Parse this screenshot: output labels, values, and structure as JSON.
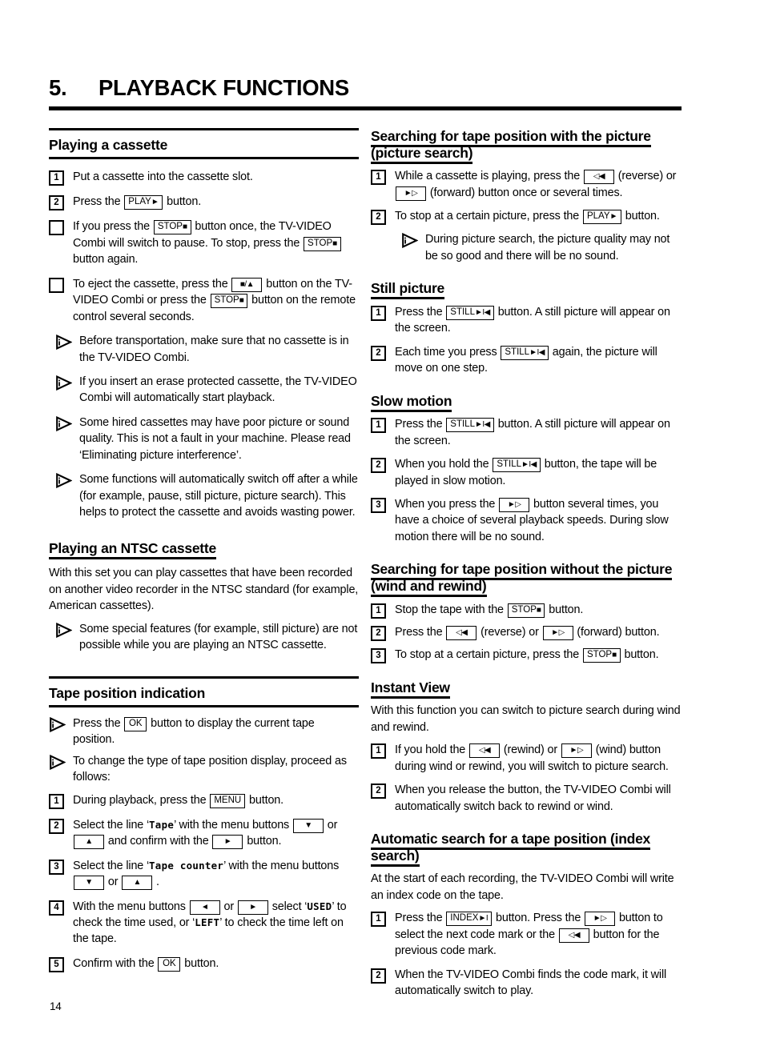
{
  "chapter": {
    "number": "5.",
    "title": "PLAYBACK FUNCTIONS"
  },
  "page_number": "14",
  "keys": {
    "play": "PLAY",
    "play_glyph": "►",
    "stop": "STOP",
    "stop_glyph": "■",
    "eject": "■/▲",
    "rewind": "◁◀",
    "forward": "►▷",
    "still": "STILL",
    "still_glyph": "►I◀",
    "index": "INDEX",
    "index_glyph": "►I",
    "ok": "OK",
    "menu": "MENU",
    "down": "▼",
    "up": "▲",
    "left": "◄",
    "right": "►"
  },
  "left_column": {
    "section_playing": {
      "heading": "Playing a cassette",
      "steps": [
        {
          "marker": "1",
          "parts": [
            {
              "t": "text",
              "v": "Put a cassette into the cassette slot."
            }
          ]
        },
        {
          "marker": "2",
          "parts": [
            {
              "t": "text",
              "v": "Press the "
            },
            {
              "t": "key",
              "v": "play"
            },
            {
              "t": "text",
              "v": " button."
            }
          ]
        },
        {
          "marker": "box",
          "parts": [
            {
              "t": "text",
              "v": "If you press the "
            },
            {
              "t": "key",
              "v": "stop"
            },
            {
              "t": "text",
              "v": " button once, the TV-VIDEO Combi will switch to pause. To stop, press the "
            },
            {
              "t": "key",
              "v": "stop"
            },
            {
              "t": "text",
              "v": " button again."
            }
          ]
        },
        {
          "marker": "box",
          "parts": [
            {
              "t": "text",
              "v": "To eject the cassette, press the "
            },
            {
              "t": "key",
              "v": "eject"
            },
            {
              "t": "text",
              "v": " button on the TV-VIDEO Combi or press the "
            },
            {
              "t": "key",
              "v": "stop"
            },
            {
              "t": "text",
              "v": " button on the remote control several seconds."
            }
          ]
        }
      ],
      "tips": [
        "Before transportation, make sure that no cassette is in the TV-VIDEO Combi.",
        "If you insert an erase protected cassette, the TV-VIDEO Combi will automatically start playback.",
        "Some hired cassettes may have poor picture or sound quality. This is not a fault in your machine. Please read ‘Eliminating picture interference’.",
        "Some functions will automatically switch off after a while (for example, pause, still picture, picture search). This helps to protect the cassette and avoids wasting power."
      ]
    },
    "section_ntsc": {
      "heading": "Playing an NTSC cassette",
      "body": "With this set you can play cassettes that have been recorded on another video recorder in the NTSC standard (for example, American cassettes).",
      "tip": "Some special features (for example, still picture) are not possible while you are playing an NTSC cassette."
    },
    "section_tape_position": {
      "heading": "Tape position indication",
      "tip1_parts": [
        {
          "t": "text",
          "v": "Press the "
        },
        {
          "t": "key",
          "v": "ok"
        },
        {
          "t": "text",
          "v": " button to display the current tape position."
        }
      ],
      "tip2": "To change the type of tape position display, proceed as follows:",
      "steps": [
        {
          "marker": "1",
          "parts": [
            {
              "t": "text",
              "v": "During playback, press the "
            },
            {
              "t": "key",
              "v": "menu"
            },
            {
              "t": "text",
              "v": " button."
            }
          ]
        },
        {
          "marker": "2",
          "parts": [
            {
              "t": "text",
              "v": "Select the line ‘"
            },
            {
              "t": "mono",
              "v": "Tape"
            },
            {
              "t": "text",
              "v": "’ with the menu buttons "
            },
            {
              "t": "key",
              "v": "down"
            },
            {
              "t": "text",
              "v": " or "
            },
            {
              "t": "key",
              "v": "up"
            },
            {
              "t": "text",
              "v": " and confirm with the "
            },
            {
              "t": "key",
              "v": "right"
            },
            {
              "t": "text",
              "v": " button."
            }
          ]
        },
        {
          "marker": "3",
          "parts": [
            {
              "t": "text",
              "v": "Select the line ‘"
            },
            {
              "t": "mono",
              "v": "Tape counter"
            },
            {
              "t": "text",
              "v": "’ with the menu buttons "
            },
            {
              "t": "key",
              "v": "down"
            },
            {
              "t": "text",
              "v": " or "
            },
            {
              "t": "key",
              "v": "up"
            },
            {
              "t": "text",
              "v": " ."
            }
          ]
        },
        {
          "marker": "4",
          "parts": [
            {
              "t": "text",
              "v": "With the menu buttons "
            },
            {
              "t": "key",
              "v": "left"
            },
            {
              "t": "text",
              "v": " or "
            },
            {
              "t": "key",
              "v": "right"
            },
            {
              "t": "text",
              "v": " select ‘"
            },
            {
              "t": "mono",
              "v": "USED"
            },
            {
              "t": "text",
              "v": "’ to check the time used, or ‘"
            },
            {
              "t": "mono",
              "v": "LEFT"
            },
            {
              "t": "text",
              "v": "’ to check the time left on the tape."
            }
          ]
        },
        {
          "marker": "5",
          "parts": [
            {
              "t": "text",
              "v": "Confirm with the "
            },
            {
              "t": "key",
              "v": "ok"
            },
            {
              "t": "text",
              "v": " button."
            }
          ]
        }
      ]
    }
  },
  "right_column": {
    "section_picture_search": {
      "heading": "Searching for tape position with the picture (picture search)",
      "steps": [
        {
          "marker": "1",
          "parts": [
            {
              "t": "text",
              "v": "While a cassette is playing, press the "
            },
            {
              "t": "key",
              "v": "rewind"
            },
            {
              "t": "text",
              "v": " (reverse) or "
            },
            {
              "t": "key",
              "v": "forward"
            },
            {
              "t": "text",
              "v": " (forward) button once or several times."
            }
          ]
        },
        {
          "marker": "2",
          "parts": [
            {
              "t": "text",
              "v": "To stop at a certain picture, press the "
            },
            {
              "t": "key",
              "v": "play"
            },
            {
              "t": "text",
              "v": " button."
            }
          ]
        }
      ],
      "tip": "During picture search, the picture quality may not be so good and there will be no sound."
    },
    "section_still_picture": {
      "heading": "Still picture",
      "steps": [
        {
          "marker": "1",
          "parts": [
            {
              "t": "text",
              "v": "Press the "
            },
            {
              "t": "key",
              "v": "still"
            },
            {
              "t": "text",
              "v": " button. A still picture will appear on the screen."
            }
          ]
        },
        {
          "marker": "2",
          "parts": [
            {
              "t": "text",
              "v": "Each time you press "
            },
            {
              "t": "key",
              "v": "still"
            },
            {
              "t": "text",
              "v": " again, the picture will move on one step."
            }
          ]
        }
      ]
    },
    "section_slow_motion": {
      "heading": "Slow motion",
      "steps": [
        {
          "marker": "1",
          "parts": [
            {
              "t": "text",
              "v": "Press the "
            },
            {
              "t": "key",
              "v": "still"
            },
            {
              "t": "text",
              "v": " button. A still picture will appear on the screen."
            }
          ]
        },
        {
          "marker": "2",
          "parts": [
            {
              "t": "text",
              "v": "When you hold the "
            },
            {
              "t": "key",
              "v": "still"
            },
            {
              "t": "text",
              "v": " button, the tape will be played in slow motion."
            }
          ]
        },
        {
          "marker": "3",
          "parts": [
            {
              "t": "text",
              "v": "When you press the "
            },
            {
              "t": "key",
              "v": "forward"
            },
            {
              "t": "text",
              "v": " button several times, you have a choice of several playback speeds. During slow motion there will be no sound."
            }
          ]
        }
      ]
    },
    "section_wind_rewind": {
      "heading": "Searching for tape position without the picture (wind and rewind)",
      "steps": [
        {
          "marker": "1",
          "parts": [
            {
              "t": "text",
              "v": "Stop the tape with the "
            },
            {
              "t": "key",
              "v": "stop"
            },
            {
              "t": "text",
              "v": " button."
            }
          ]
        },
        {
          "marker": "2",
          "parts": [
            {
              "t": "text",
              "v": "Press the "
            },
            {
              "t": "key",
              "v": "rewind"
            },
            {
              "t": "text",
              "v": " (reverse) or "
            },
            {
              "t": "key",
              "v": "forward"
            },
            {
              "t": "text",
              "v": " (forward) button."
            }
          ]
        },
        {
          "marker": "3",
          "parts": [
            {
              "t": "text",
              "v": "To stop at a certain picture, press the "
            },
            {
              "t": "key",
              "v": "stop"
            },
            {
              "t": "text",
              "v": " button."
            }
          ]
        }
      ]
    },
    "section_instant_view": {
      "heading": "Instant View",
      "body": "With this function you can switch to picture search during wind and rewind.",
      "steps": [
        {
          "marker": "1",
          "parts": [
            {
              "t": "text",
              "v": "If you hold the "
            },
            {
              "t": "key",
              "v": "rewind"
            },
            {
              "t": "text",
              "v": " (rewind) or "
            },
            {
              "t": "key",
              "v": "forward"
            },
            {
              "t": "text",
              "v": " (wind) button during wind or rewind, you will switch to picture search."
            }
          ]
        },
        {
          "marker": "2",
          "parts": [
            {
              "t": "text",
              "v": "When you release the button, the TV-VIDEO Combi will automatically switch back to rewind or wind."
            }
          ]
        }
      ]
    },
    "section_index_search": {
      "heading": "Automatic search for a tape position (index search)",
      "body": "At the start of each recording, the TV-VIDEO Combi will write an index code on the tape.",
      "steps": [
        {
          "marker": "1",
          "parts": [
            {
              "t": "text",
              "v": "Press the "
            },
            {
              "t": "key",
              "v": "index"
            },
            {
              "t": "text",
              "v": " button. Press the "
            },
            {
              "t": "key",
              "v": "forward"
            },
            {
              "t": "text",
              "v": " button to select the next code mark or the "
            },
            {
              "t": "key",
              "v": "rewind"
            },
            {
              "t": "text",
              "v": " button for the previous code mark."
            }
          ]
        },
        {
          "marker": "2",
          "parts": [
            {
              "t": "text",
              "v": "When the TV-VIDEO Combi finds the code mark, it will automatically switch to play."
            }
          ]
        }
      ]
    }
  }
}
